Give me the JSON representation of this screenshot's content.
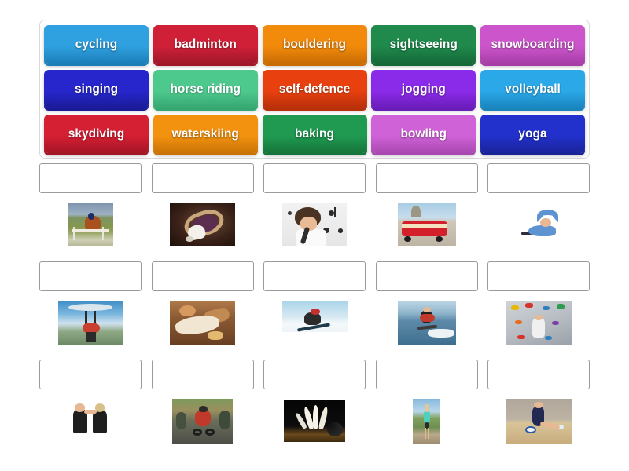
{
  "wordbank": {
    "rows": [
      [
        {
          "label": "cycling",
          "color": "#2fa0e0",
          "color_dark": "#1c7fb8"
        },
        {
          "label": "badminton",
          "color": "#cf2038",
          "color_dark": "#a1172a"
        },
        {
          "label": "bouldering",
          "color": "#f28a0c",
          "color_dark": "#c86c04"
        },
        {
          "label": "sightseeing",
          "color": "#1f8a4c",
          "color_dark": "#156838"
        },
        {
          "label": "snowboarding",
          "color": "#cc55cc",
          "color_dark": "#a63da6"
        }
      ],
      [
        {
          "label": "singing",
          "color": "#2626cc",
          "color_dark": "#1b1b99"
        },
        {
          "label": "horse riding",
          "color": "#4ec98e",
          "color_dark": "#35a770"
        },
        {
          "label": "self-defence",
          "color": "#e8400f",
          "color_dark": "#b6300a"
        },
        {
          "label": "jogging",
          "color": "#8b2bea",
          "color_dark": "#6a1cb8"
        },
        {
          "label": "volleyball",
          "color": "#2aa8e8",
          "color_dark": "#1a85bd"
        }
      ],
      [
        {
          "label": "skydiving",
          "color": "#d51f33",
          "color_dark": "#a41525"
        },
        {
          "label": "waterskiing",
          "color": "#f3920f",
          "color_dark": "#c97305"
        },
        {
          "label": "baking",
          "color": "#1f9a50",
          "color_dark": "#16753b"
        },
        {
          "label": "bowling",
          "color": "#d062d8",
          "color_dark": "#a948b0"
        },
        {
          "label": "yoga",
          "color": "#2231cc",
          "color_dark": "#192499"
        }
      ]
    ]
  },
  "grid": {
    "dropzone_placeholder": "",
    "rows": [
      [
        {
          "dropzone_value": "",
          "image": "horse-riding-photo"
        },
        {
          "dropzone_value": "",
          "image": "badminton-photo"
        },
        {
          "dropzone_value": "",
          "image": "singing-photo"
        },
        {
          "dropzone_value": "",
          "image": "sightseeing-photo"
        },
        {
          "dropzone_value": "",
          "image": "yoga-photo"
        }
      ],
      [
        {
          "dropzone_value": "",
          "image": "skydiving-photo"
        },
        {
          "dropzone_value": "",
          "image": "baking-photo"
        },
        {
          "dropzone_value": "",
          "image": "snowboarding-photo"
        },
        {
          "dropzone_value": "",
          "image": "waterskiing-photo"
        },
        {
          "dropzone_value": "",
          "image": "bouldering-photo"
        }
      ],
      [
        {
          "dropzone_value": "",
          "image": "self-defence-photo"
        },
        {
          "dropzone_value": "",
          "image": "cycling-photo"
        },
        {
          "dropzone_value": "",
          "image": "bowling-photo"
        },
        {
          "dropzone_value": "",
          "image": "jogging-photo"
        },
        {
          "dropzone_value": "",
          "image": "volleyball-photo"
        }
      ]
    ]
  },
  "theme": {
    "page_background": "#ffffff",
    "wordbank_border": "#d9d9d9",
    "dropzone_border": "#9b9b9b",
    "tile_text_color": "#ffffff"
  }
}
